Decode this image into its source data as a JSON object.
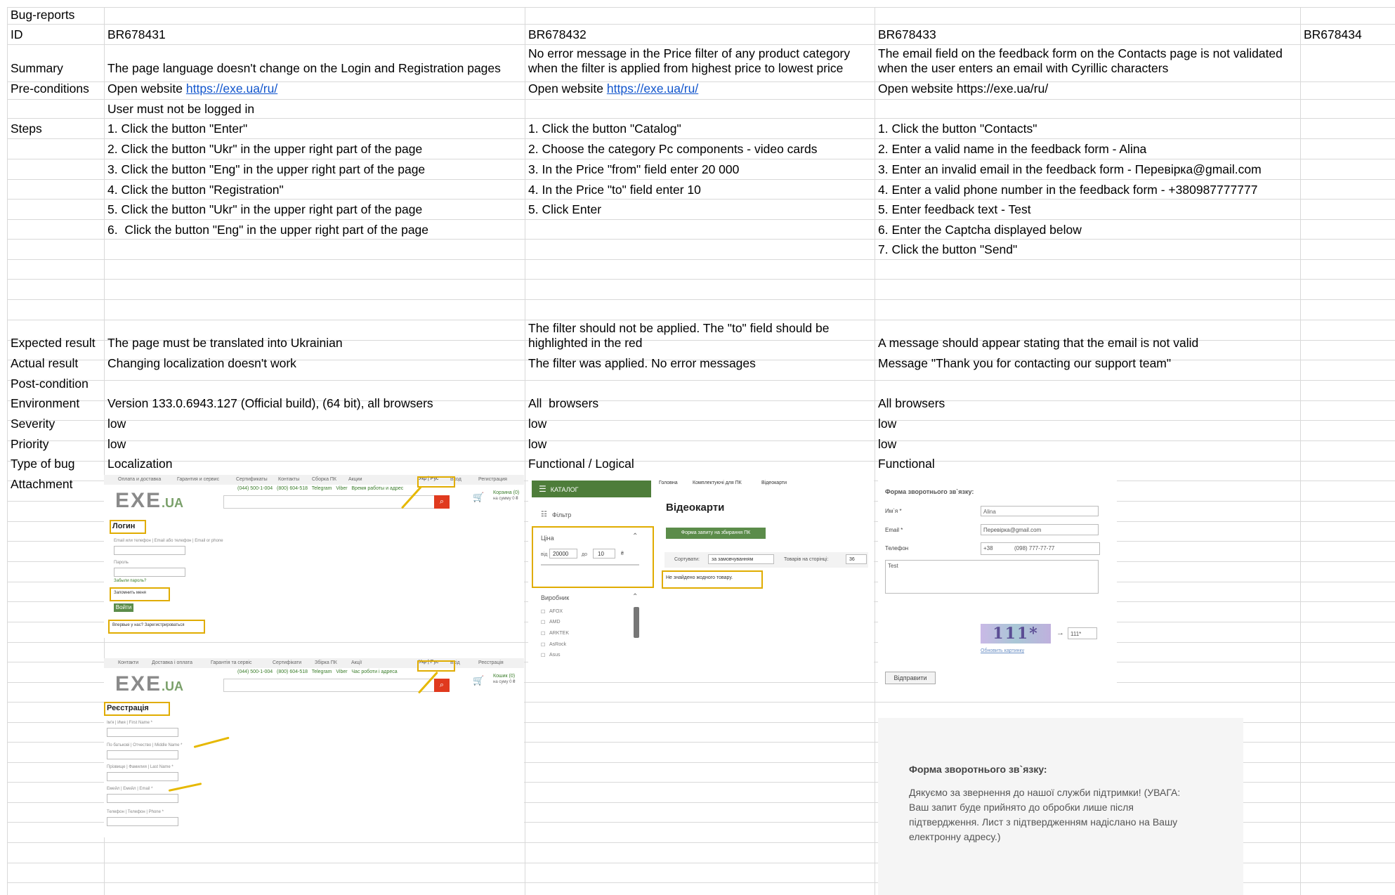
{
  "sheet": {
    "title": "Bug-reports",
    "ids": [
      "BR678431",
      "BR678432",
      "BR678433",
      "BR678434"
    ],
    "row_labels": {
      "id": "ID",
      "summary": "Summary",
      "preconditions": "Pre-conditions",
      "steps": "Steps",
      "expected": "Expected result",
      "actual": "Actual result",
      "postcondition": "Post-condition",
      "environment": "Environment",
      "severity": "Severity",
      "priority": "Priority",
      "type": "Type of bug",
      "attachment": "Attachment"
    },
    "bugs": [
      {
        "summary": [
          "The page language doesn't change on the Login and Registration pages"
        ],
        "pre_prefix": "Open website ",
        "pre_link": "https://exe.ua/ru/",
        "pre_extra": "User must not be logged in",
        "steps": [
          "1. Click the button \"Enter\"",
          "2. Click the button \"Ukr\" in the upper right part of the page",
          "3. Click the button \"Eng\" in the upper right part of the page",
          "4. Click the button \"Registration\"",
          "5. Click the button \"Ukr\" in the upper right part of the page",
          "6.  Click the button \"Eng\" in the upper right part of the page"
        ],
        "expected": [
          "The page must be translated into Ukrainian"
        ],
        "actual": "Changing localization doesn't work",
        "environment": "Version 133.0.6943.127 (Official build), (64 bit), all browsers",
        "severity": "low",
        "priority": "low",
        "type": "Localization"
      },
      {
        "summary": [
          "No error message in the Price filter of any product category",
          "when the filter is applied from highest price to lowest price"
        ],
        "pre_prefix": "Open website ",
        "pre_link": "https://exe.ua/ru/",
        "steps": [
          "1. Click the button \"Catalog\"",
          "2. Choose the category Pc components - video cards",
          "3. In the Price \"from\" field enter 20 000",
          "4. In the Price \"to\" field enter 10",
          "5. Click Enter"
        ],
        "expected": [
          "The filter should not be applied. The \"to\" field should be",
          "highlighted in the red"
        ],
        "actual": "The filter was applied. No error messages",
        "environment": "All  browsers",
        "severity": "low",
        "priority": "low",
        "type": "Functional / Logical"
      },
      {
        "summary": [
          "The email field on the feedback form on the Contacts page is not validated",
          "when the user enters an email with Cyrillic characters"
        ],
        "pre_text": "Open website https://exe.ua/ru/",
        "steps": [
          "1. Click the button \"Contacts\"",
          "2. Enter a valid name in the feedback form - Alina",
          "3. Enter an invalid email in the feedback form - Перевірка@gmail.com",
          "4. Enter a valid phone number in the feedback form - +380987777777",
          "5. Enter feedback text - Test",
          "6. Enter the Captcha displayed below",
          "7. Click the button \"Send\""
        ],
        "expected": [
          "A message should appear stating that the email is not valid"
        ],
        "actual": "Message \"Thank you for contacting our support team\"",
        "environment": "All browsers",
        "severity": "low",
        "priority": "low",
        "type": "Functional"
      }
    ]
  },
  "shot_login": {
    "topnav": [
      "Оплата и доставка",
      "Гарантия и сервис",
      "Сертификаты",
      "Контакты",
      "Сборка ПК",
      "Акции"
    ],
    "lang": "Укр | Рус",
    "login_link": "Вход",
    "register_link": "Регистрация",
    "logo": "EXE",
    "logo_suffix": ".UA",
    "phones": "(044) 500-1-004   (800) 604-518   Telegram   Viber   Время работы и адрес",
    "cart": "Корзина (0)",
    "cart_sum": "на сумму 0 ₴",
    "heading": "Логин",
    "email_label": "Email или телефон | Email або телефон | Email or phone",
    "password_label": "Пароль",
    "forgot": "Забыли пароль?",
    "remember": "Запомнить меня",
    "login_button": "Войти",
    "first_time": "Впервые у нас? Зарегистрироваться"
  },
  "shot_register": {
    "topnav": [
      "Контакти",
      "Доставка і оплата",
      "Гарантія та сервіс",
      "Сертифікати",
      "Збірка ПК",
      "Акції"
    ],
    "lang": "Укр | Рус",
    "login_link": "Вхід",
    "register_link": "Реєстрація",
    "logo": "EXE",
    "logo_suffix": ".UA",
    "phones": "(044) 500-1-004   (800) 604-518   Telegram   Viber   Час роботи і адреса",
    "cart": "Кошик (0)",
    "cart_sum": "на суму 0 ₴",
    "heading": "Реєстрація",
    "fields": [
      "Ім'я | Имя | First Name *",
      "По батькові | Отчество | Middle Name *",
      "Прізвище | Фамилия | Last Name *",
      "Емейл | Емейл | Email *",
      "Телефон | Телефон | Phone *"
    ]
  },
  "shot_catalog": {
    "catalog": "КАТАЛОГ",
    "breadcrumb": [
      "Головна",
      "Комплектуючі для ПК",
      "Відеокарти"
    ],
    "page_title": "Відеокарти",
    "assembly_button": "Форма запиту на збирання ПК",
    "filter": "Фільтр",
    "price": "Ціна",
    "from_label": "від",
    "from_value": "20000",
    "to_label": "до",
    "to_value": "10",
    "currency": "₴",
    "sort_label": "Сортувати:",
    "sort_value": "за замовчуванням",
    "per_page_label": "Товарів на сторінці:",
    "per_page_value": "36",
    "not_found": "Не знайдено жодного товару.",
    "maker": "Виробник",
    "makers": [
      "AFOX",
      "AMD",
      "ARKTEK",
      "AsRock",
      "Asus"
    ]
  },
  "shot_feedback": {
    "title": "Форма зворотнього зв`язку:",
    "name_label": "Им`я *",
    "name_value": "Alina",
    "email_label": "Email *",
    "email_value": "Перевірка@gmail.com",
    "phone_label": "Телефон",
    "phone_prefix": "+38",
    "phone_value": "(098) 777-77-77",
    "message_value": "Test",
    "captcha_text": "111*",
    "captcha_input": "111*",
    "refresh": "Обновить картинку",
    "send_button": "Відправити"
  },
  "shot_thanks": {
    "title": "Форма зворотнього зв`язку:",
    "lines": [
      "Дякуємо за звернення до нашої служби підтримки! (УВАГА:",
      "Ваш запит буде прийнято до обробки лише після",
      "підтвердження. Лист з підтвердженням надіслано на Вашу",
      "електронну адресу.)"
    ]
  }
}
